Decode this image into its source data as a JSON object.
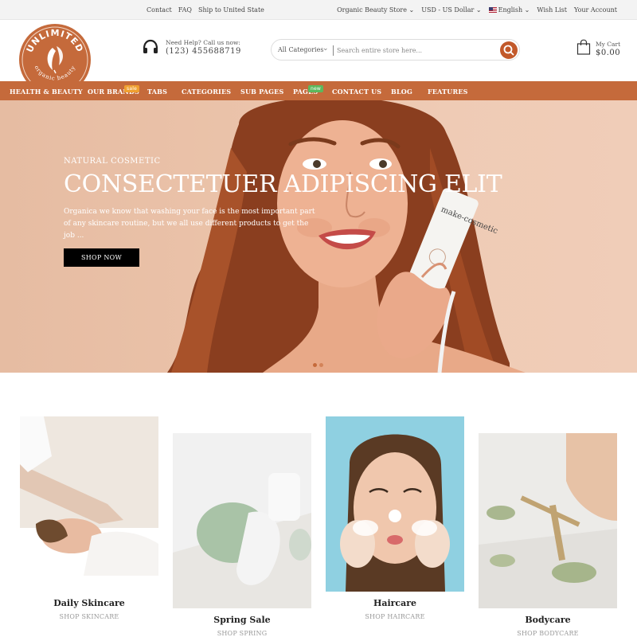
{
  "topbar": {
    "left_links": [
      "Contact",
      "FAQ",
      "Ship to United State"
    ],
    "store": "Organic Beauty Store",
    "currency": "USD - US Dollar",
    "language": "English",
    "wishlist": "Wish List",
    "account": "Your Account"
  },
  "logo": {
    "top": "UNLIMITED",
    "bottom": "organic beauty"
  },
  "help": {
    "label": "Need Help? Call us now:",
    "phone": "(123) 455688719"
  },
  "search": {
    "category": "All Categories",
    "placeholder": "Search entire store here..."
  },
  "cart": {
    "label": "My Cart",
    "total": "$0.00"
  },
  "nav": {
    "items": [
      "HEALTH & BEAUTY",
      "OUR BRANDS",
      "TABS",
      "CATEGORIES",
      "SUB PAGES",
      "PAGES",
      "CONTACT US",
      "BLOG",
      "FEATURES"
    ],
    "badge_sale": "sale",
    "badge_new": "new"
  },
  "hero": {
    "eyebrow": "NATURAL COSMETIC",
    "headline": "CONSECTETUER ADIPISCING ELIT",
    "desc_line1": "Organica we know that washing your face is the most important part",
    "desc_line2": "of any skincare routine, but we all use different products to get the job ...",
    "button": "SHOP NOW",
    "tube_text": "make-cosmetic"
  },
  "categories": [
    {
      "title": "Daily Skincare",
      "link": "SHOP SKINCARE"
    },
    {
      "title": "Spring Sale",
      "link": "SHOP SPRING"
    },
    {
      "title": "Haircare",
      "link": "SHOP HAIRCARE"
    },
    {
      "title": "Bodycare",
      "link": "SHOP BODYCARE"
    }
  ],
  "colors": {
    "brand": "#c56a3b",
    "search_button": "#c2592a",
    "badge_sale": "#f0a030",
    "badge_new": "#5cb85c"
  }
}
